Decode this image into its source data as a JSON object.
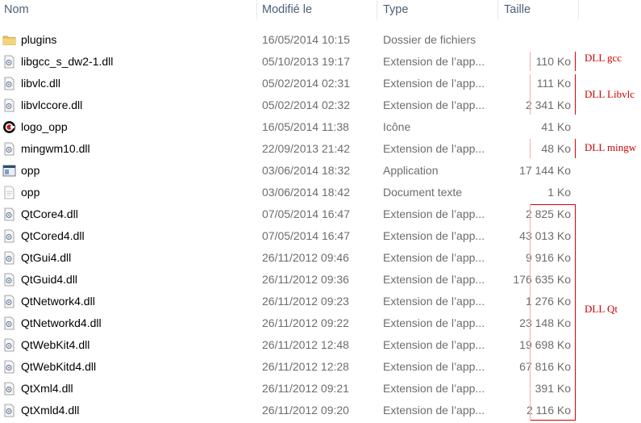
{
  "columns": {
    "name": "Nom",
    "modified": "Modifié le",
    "type": "Type",
    "size": "Taille"
  },
  "files": [
    {
      "name": "plugins",
      "date": "16/05/2014 10:15",
      "type": "Dossier de fichiers",
      "size": "",
      "icon": "folder-icon"
    },
    {
      "name": "libgcc_s_dw2-1.dll",
      "date": "05/10/2013 19:17",
      "type": "Extension de l’app...",
      "size": "110 Ko",
      "icon": "dll-file-icon"
    },
    {
      "name": "libvlc.dll",
      "date": "05/02/2014 02:31",
      "type": "Extension de l’app...",
      "size": "111 Ko",
      "icon": "dll-file-icon"
    },
    {
      "name": "libvlccore.dll",
      "date": "05/02/2014 02:32",
      "type": "Extension de l’app...",
      "size": "2 341 Ko",
      "icon": "dll-file-icon"
    },
    {
      "name": "logo_opp",
      "date": "16/05/2014 11:38",
      "type": "Icône",
      "size": "41 Ko",
      "icon": "logo-icon"
    },
    {
      "name": "mingwm10.dll",
      "date": "22/09/2013 21:42",
      "type": "Extension de l’app...",
      "size": "48 Ko",
      "icon": "dll-file-icon"
    },
    {
      "name": "opp",
      "date": "03/06/2014 18:32",
      "type": "Application",
      "size": "17 144 Ko",
      "icon": "application-icon"
    },
    {
      "name": "opp",
      "date": "03/06/2014 18:42",
      "type": "Document texte",
      "size": "1 Ko",
      "icon": "text-document-icon"
    },
    {
      "name": "QtCore4.dll",
      "date": "07/05/2014 16:47",
      "type": "Extension de l’app...",
      "size": "2 825 Ko",
      "icon": "dll-file-icon"
    },
    {
      "name": "QtCored4.dll",
      "date": "07/05/2014 16:47",
      "type": "Extension de l’app...",
      "size": "43 013 Ko",
      "icon": "dll-file-icon"
    },
    {
      "name": "QtGui4.dll",
      "date": "26/11/2012 09:46",
      "type": "Extension de l’app...",
      "size": "9 916 Ko",
      "icon": "dll-file-icon"
    },
    {
      "name": "QtGuid4.dll",
      "date": "26/11/2012 09:36",
      "type": "Extension de l’app...",
      "size": "176 635 Ko",
      "icon": "dll-file-icon"
    },
    {
      "name": "QtNetwork4.dll",
      "date": "26/11/2012 09:23",
      "type": "Extension de l’app...",
      "size": "1 276 Ko",
      "icon": "dll-file-icon"
    },
    {
      "name": "QtNetworkd4.dll",
      "date": "26/11/2012 09:22",
      "type": "Extension de l’app...",
      "size": "23 148 Ko",
      "icon": "dll-file-icon"
    },
    {
      "name": "QtWebKit4.dll",
      "date": "26/11/2012 12:48",
      "type": "Extension de l’app...",
      "size": "19 698 Ko",
      "icon": "dll-file-icon"
    },
    {
      "name": "QtWebKitd4.dll",
      "date": "26/11/2012 12:28",
      "type": "Extension de l’app...",
      "size": "67 816 Ko",
      "icon": "dll-file-icon"
    },
    {
      "name": "QtXml4.dll",
      "date": "26/11/2012 09:21",
      "type": "Extension de l’app...",
      "size": "391 Ko",
      "icon": "dll-file-icon"
    },
    {
      "name": "QtXmld4.dll",
      "date": "26/11/2012 09:20",
      "type": "Extension de l’app...",
      "size": "2 116 Ko",
      "icon": "dll-file-icon"
    }
  ],
  "annotations": {
    "dll_gcc": "DLL gcc",
    "dll_libvlc": "DLL Libvlc",
    "dll_mingw": "DLL mingw",
    "dll_qt": "DLL Qt"
  },
  "colors": {
    "annotation": "#d00000",
    "header_text": "#4c607a",
    "secondary_text": "#6d6d6d",
    "folder": "#e8c05a"
  }
}
